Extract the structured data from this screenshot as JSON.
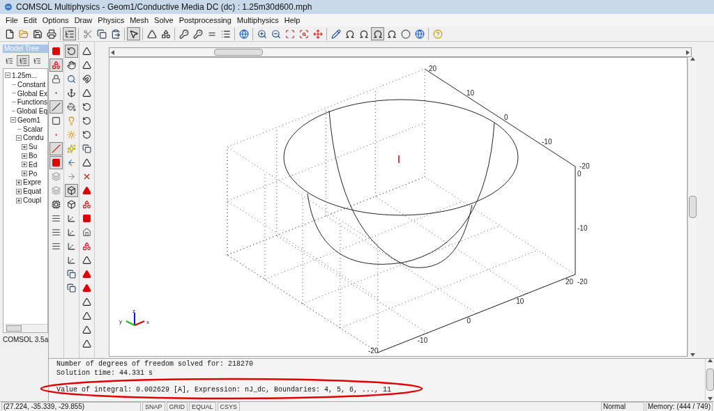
{
  "window": {
    "title": "COMSOL Multiphysics - Geom1/Conductive Media DC (dc) : 1.25m30d600.mph"
  },
  "menu": [
    "File",
    "Edit",
    "Options",
    "Draw",
    "Physics",
    "Mesh",
    "Solve",
    "Postprocessing",
    "Multiphysics",
    "Help"
  ],
  "toolbar": [
    {
      "kind": "new",
      "pressed": false
    },
    {
      "kind": "open",
      "pressed": false
    },
    {
      "kind": "save",
      "pressed": false
    },
    {
      "kind": "print",
      "pressed": false
    },
    {
      "kind": "sep"
    },
    {
      "kind": "tree",
      "pressed": true
    },
    {
      "kind": "sep"
    },
    {
      "kind": "cut",
      "pressed": false
    },
    {
      "kind": "copy",
      "pressed": false
    },
    {
      "kind": "paste",
      "pressed": false
    },
    {
      "kind": "sep"
    },
    {
      "kind": "pointer",
      "pressed": true
    },
    {
      "kind": "sep"
    },
    {
      "kind": "triangle",
      "pressed": false
    },
    {
      "kind": "triangles",
      "pressed": false
    },
    {
      "kind": "sep"
    },
    {
      "kind": "key",
      "pressed": false
    },
    {
      "kind": "key",
      "pressed": false
    },
    {
      "kind": "equal",
      "pressed": false
    },
    {
      "kind": "list",
      "pressed": false
    },
    {
      "kind": "sep"
    },
    {
      "kind": "sphere",
      "pressed": false
    },
    {
      "kind": "sep"
    },
    {
      "kind": "zoomin",
      "pressed": false
    },
    {
      "kind": "zoomout",
      "pressed": false
    },
    {
      "kind": "zoombox",
      "pressed": false
    },
    {
      "kind": "zoomfit",
      "pressed": false
    },
    {
      "kind": "move",
      "pressed": false
    },
    {
      "kind": "sep"
    },
    {
      "kind": "pencil",
      "pressed": false
    },
    {
      "kind": "omega",
      "pressed": false
    },
    {
      "kind": "omega",
      "pressed": false
    },
    {
      "kind": "omega",
      "pressed": true
    },
    {
      "kind": "omega",
      "pressed": false
    },
    {
      "kind": "circle",
      "pressed": false
    },
    {
      "kind": "sphere",
      "pressed": false
    },
    {
      "kind": "sep"
    },
    {
      "kind": "help",
      "pressed": false
    }
  ],
  "model_tree": {
    "title": "Model Tree",
    "view_buttons": [
      {
        "selected": false
      },
      {
        "selected": true
      },
      {
        "selected": false
      }
    ],
    "items": [
      {
        "label": "1.25m...",
        "expanded": true,
        "children": [
          {
            "label": "Constant"
          },
          {
            "label": "Global Ex"
          },
          {
            "label": "Functions"
          },
          {
            "label": "Global Eq"
          },
          {
            "label": "Geom1",
            "expanded": true,
            "children": [
              {
                "label": "Scalar"
              },
              {
                "label": "Condu",
                "expanded": true,
                "children": [
                  {
                    "label": "Su",
                    "expanded": false
                  },
                  {
                    "label": "Bo",
                    "expanded": false
                  },
                  {
                    "label": "Ed",
                    "expanded": false
                  },
                  {
                    "label": "Po",
                    "expanded": false
                  }
                ]
              },
              {
                "label": "Expre",
                "expanded": false
              },
              {
                "label": "Equat",
                "expanded": false
              },
              {
                "label": "Coupl",
                "expanded": false
              }
            ]
          }
        ]
      }
    ],
    "version": "COMSOL 3.5a"
  },
  "tool_columns": [
    [
      {
        "kind": "redsquare",
        "pressed": false
      },
      {
        "kind": "redshape",
        "pressed": true
      },
      {
        "kind": "lock",
        "pressed": false
      },
      {
        "kind": "dot",
        "pressed": false
      },
      {
        "kind": "line",
        "pressed": true
      },
      {
        "kind": "square",
        "pressed": false
      },
      {
        "kind": "reddot",
        "pressed": false
      },
      {
        "kind": "redline",
        "pressed": true
      },
      {
        "kind": "redsquare",
        "pressed": true
      },
      {
        "kind": "stack",
        "pressed": false
      },
      {
        "kind": "stack",
        "pressed": false
      },
      {
        "kind": "chip",
        "pressed": false
      },
      {
        "kind": "bars",
        "pressed": false
      },
      {
        "kind": "bars",
        "pressed": false
      },
      {
        "kind": "bars",
        "pressed": false
      }
    ],
    [
      {
        "kind": "rotate",
        "pressed": true
      },
      {
        "kind": "hand",
        "pressed": false
      },
      {
        "kind": "zoom",
        "pressed": false
      },
      {
        "kind": "anchor",
        "pressed": false
      },
      {
        "kind": "paint",
        "pressed": false
      },
      {
        "kind": "bulb",
        "pressed": false
      },
      {
        "kind": "sun",
        "pressed": false
      },
      {
        "kind": "sparkle",
        "pressed": false
      },
      {
        "kind": "left",
        "pressed": false
      },
      {
        "kind": "right",
        "pressed": false
      },
      {
        "kind": "cube",
        "pressed": true
      },
      {
        "kind": "cube",
        "pressed": false
      },
      {
        "kind": "axes",
        "pressed": false
      },
      {
        "kind": "axes",
        "pressed": false
      },
      {
        "kind": "axes",
        "pressed": false
      },
      {
        "kind": "axes",
        "pressed": false
      },
      {
        "kind": "copy",
        "pressed": false
      },
      {
        "kind": "copy",
        "pressed": false
      }
    ],
    [
      {
        "kind": "triangle",
        "pressed": false
      },
      {
        "kind": "triangle",
        "pressed": false
      },
      {
        "kind": "magnet",
        "pressed": false
      },
      {
        "kind": "triangle",
        "pressed": false
      },
      {
        "kind": "rotate",
        "pressed": false
      },
      {
        "kind": "rotate",
        "pressed": false
      },
      {
        "kind": "rotate",
        "pressed": false
      },
      {
        "kind": "copy",
        "pressed": false
      },
      {
        "kind": "triangle",
        "pressed": false
      },
      {
        "kind": "cross",
        "pressed": false
      },
      {
        "kind": "redtriangle",
        "pressed": false
      },
      {
        "kind": "redshape",
        "pressed": false
      },
      {
        "kind": "redsquare",
        "pressed": false
      },
      {
        "kind": "house",
        "pressed": false
      },
      {
        "kind": "redshape",
        "pressed": false
      },
      {
        "kind": "triangle",
        "pressed": false
      },
      {
        "kind": "redtriangle",
        "pressed": false
      },
      {
        "kind": "redtriangle",
        "pressed": false
      },
      {
        "kind": "triangle",
        "pressed": false
      },
      {
        "kind": "triangle",
        "pressed": false
      },
      {
        "kind": "triangle",
        "pressed": false
      },
      {
        "kind": "triangle",
        "pressed": false
      }
    ]
  ],
  "plot": {
    "y_axis_labels": [
      "20",
      "10",
      "0",
      "-10",
      "-20"
    ],
    "z_axis_labels": [
      "0",
      "-10",
      "-20"
    ],
    "x_axis_labels": [
      "20",
      "10",
      "0",
      "-10",
      "-20"
    ],
    "triad": {
      "x": "x",
      "y": "y",
      "z": "z"
    }
  },
  "messages": [
    "Number of degrees of freedom solved for: 218270",
    "Solution time: 44.331 s",
    "Value of integral: 0.002629 [A], Expression: nJ_dc, Boundaries: 4, 5, 6, ..., 11"
  ],
  "status_bar": {
    "coordinates": "(27.224, -35.339, -29.855)",
    "toggles": [
      {
        "label": "SNAP",
        "on": false
      },
      {
        "label": "GRID",
        "on": false
      },
      {
        "label": "EQUAL",
        "on": false
      },
      {
        "label": "CSYS",
        "on": false
      }
    ],
    "mode": "Normal",
    "memory": "Memory: (444 / 749)"
  }
}
